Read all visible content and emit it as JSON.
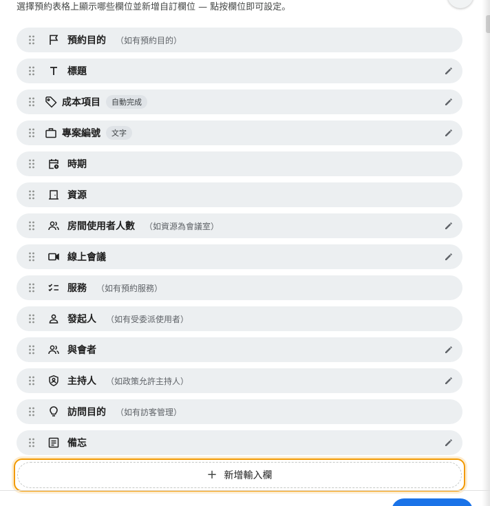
{
  "intro_text": "選擇預約表格上顯示哪些欄位並新增自訂欄位 — 點按欄位即可設定。",
  "fields": [
    {
      "label": "預約目的",
      "hint": "（如有預約目的）",
      "chip": "",
      "icon": "flag-icon",
      "editable": false
    },
    {
      "label": "標題",
      "hint": "",
      "chip": "",
      "icon": "text-icon",
      "editable": true
    },
    {
      "label": "成本項目",
      "hint": "",
      "chip": "自動完成",
      "icon": "tag-icon",
      "editable": true
    },
    {
      "label": "專案編號",
      "hint": "",
      "chip": "文字",
      "icon": "briefcase-icon",
      "editable": true
    },
    {
      "label": "時期",
      "hint": "",
      "chip": "",
      "icon": "calendar-clock-icon",
      "editable": false
    },
    {
      "label": "資源",
      "hint": "",
      "chip": "",
      "icon": "door-icon",
      "editable": false
    },
    {
      "label": "房間使用者人數",
      "hint": "（如資源為會議室）",
      "chip": "",
      "icon": "people-icon",
      "editable": true
    },
    {
      "label": "線上會議",
      "hint": "",
      "chip": "",
      "icon": "video-icon",
      "editable": true
    },
    {
      "label": "服務",
      "hint": "（如有預約服務）",
      "chip": "",
      "icon": "checklist-icon",
      "editable": false
    },
    {
      "label": "發起人",
      "hint": "（如有受委派使用者）",
      "chip": "",
      "icon": "person-icon",
      "editable": false
    },
    {
      "label": "與會者",
      "hint": "",
      "chip": "",
      "icon": "people-icon",
      "editable": true
    },
    {
      "label": "主持人",
      "hint": "（如政策允許主持人）",
      "chip": "",
      "icon": "shield-person-icon",
      "editable": true
    },
    {
      "label": "訪問目的",
      "hint": "（如有訪客管理）",
      "chip": "",
      "icon": "lightbulb-icon",
      "editable": false
    },
    {
      "label": "備忘",
      "hint": "",
      "chip": "",
      "icon": "notes-icon",
      "editable": true
    }
  ],
  "add_button": {
    "plus": "+",
    "label": "新增輸入欄"
  },
  "colors": {
    "accent": "#1a73e8",
    "focus_ring": "#f29900",
    "row_bg": "#eceff1"
  }
}
